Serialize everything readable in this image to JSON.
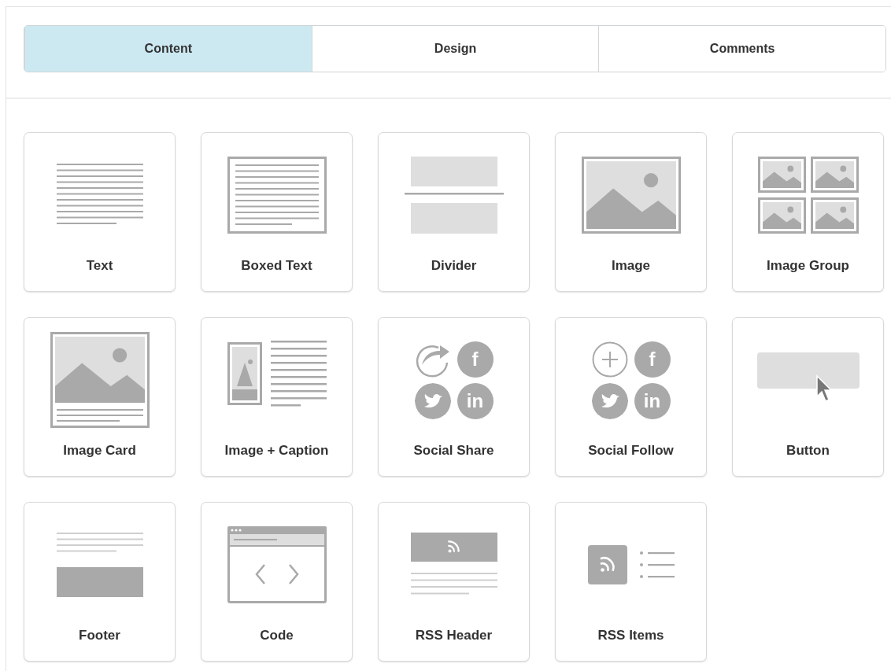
{
  "tabs": [
    {
      "label": "Content",
      "selected": true
    },
    {
      "label": "Design",
      "selected": false
    },
    {
      "label": "Comments",
      "selected": false
    }
  ],
  "blocks": [
    {
      "label": "Text",
      "kind": "text"
    },
    {
      "label": "Boxed Text",
      "kind": "boxed"
    },
    {
      "label": "Divider",
      "kind": "divider"
    },
    {
      "label": "Image",
      "kind": "image"
    },
    {
      "label": "Image Group",
      "kind": "imagegroup"
    },
    {
      "label": "Image Card",
      "kind": "imagecard"
    },
    {
      "label": "Image + Caption",
      "kind": "caption"
    },
    {
      "label": "Social Share",
      "kind": "share",
      "glyphs": [
        "f",
        "in"
      ]
    },
    {
      "label": "Social Follow",
      "kind": "follow",
      "glyphs": [
        "f",
        "in"
      ]
    },
    {
      "label": "Button",
      "kind": "button"
    },
    {
      "label": "Footer",
      "kind": "footer"
    },
    {
      "label": "Code",
      "kind": "code"
    },
    {
      "label": "RSS Header",
      "kind": "rssheader"
    },
    {
      "label": "RSS Items",
      "kind": "rssitems"
    }
  ]
}
